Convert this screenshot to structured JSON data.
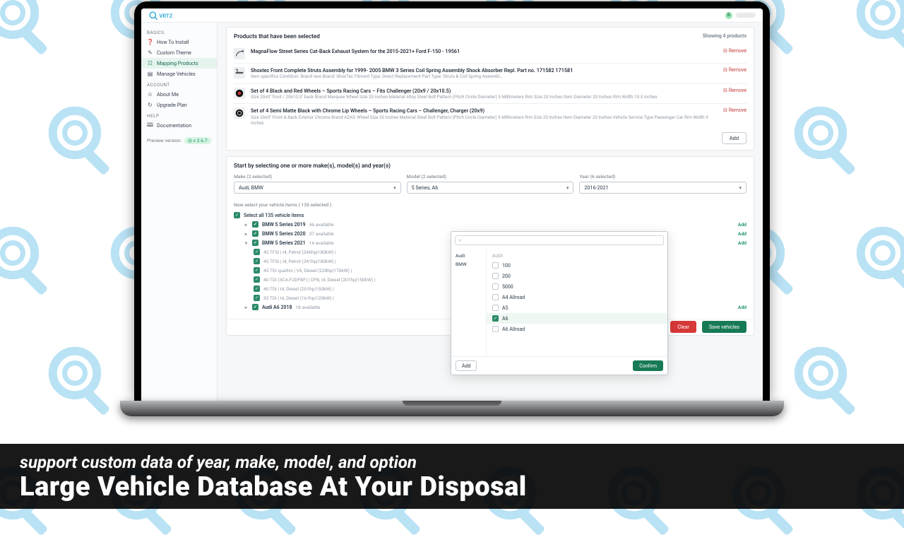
{
  "sidebar": {
    "sections": [
      {
        "label": "BASICS",
        "items": [
          {
            "label": "How To Install",
            "icon": "❓"
          },
          {
            "label": "Custom Theme",
            "icon": "✎"
          },
          {
            "label": "Mapping Products",
            "icon": "☷",
            "active": true
          },
          {
            "label": "Manage Vehicles",
            "icon": "▤"
          }
        ]
      },
      {
        "label": "ACCOUNT",
        "items": [
          {
            "label": "About Me",
            "icon": "☺"
          },
          {
            "label": "Upgrade Plan",
            "icon": "↻"
          }
        ]
      },
      {
        "label": "HELP",
        "items": [
          {
            "label": "Documentation",
            "icon": "🕮"
          }
        ]
      }
    ],
    "preview_label": "Preview version:",
    "preview_version": "◎ v 2.6.7"
  },
  "topbar": {
    "avatar_letter": "D"
  },
  "products": {
    "title": "Products that have been selected",
    "count_label": "Showing 4 products",
    "remove_label": "Remove",
    "add_label": "Add",
    "items": [
      {
        "title": "MagnaFlow Street Series Cat-Back Exhaust System for the 2015-2021+ Ford F-150 - 19561",
        "sub": ""
      },
      {
        "title": "Shoxtec Front Complete Struts Assembly for 1999- 2005 BMW 3 Series Coil Spring Assembly Shock Absorber Repl. Part no. 171582 171581",
        "sub": "Item specifics Condition: Brand new Brand: ShoxTec Fitment Type: Direct Replacement Part Type: Struts & Coil Spring Assembl…"
      },
      {
        "title": "Set of 4 Black and Red Wheels – Sports Racing Cars – Fits Challenger (20x9 / 20x10.5)",
        "sub": "Size 20x9\" front / 20x10.5\" back Brand Marquee Wheel Size 20 Inches Material Alloy Steel Bolt Pattern (Pitch Circle Diameter) 9 Millimeters Rim Size 20 Inches Item Diameter 20 Inches Rim Width 10.5 Inches"
      },
      {
        "title": "Set of 4 Semi Matte Black with Chrome Lip Wheels – Sports Racing Cars – Challenger, Charger (20x9)",
        "sub": "Size 20x9\" Front & Back Exterior Chrome Brand AZAD Wheel Size 20 Inches Material Steel Bolt Pattern (Pitch Circle Diameter) 9 Millimeters Rim Size 20 Inches Item Diameter 20 Inches Vehicle Service Type Passenger Car Rim Width 9 Inches"
      }
    ]
  },
  "selection": {
    "title": "Start by selecting one or more make(s), model(s) and year(s)",
    "make": {
      "label": "Make (2 selected)",
      "value": "Audi, BMW"
    },
    "model": {
      "label": "Model (2 selected)",
      "value": "5 Series, A6"
    },
    "year": {
      "label": "Year (6 selected)",
      "value": "2016-2021"
    },
    "vehicles_header": "Now select your vehicle items ( 135 selected )",
    "select_all": "Select all 135 vehicle items",
    "add_label": "Add",
    "groups": [
      {
        "title": "BMW 5 Series 2019",
        "avail": "46 available"
      },
      {
        "title": "BMW 5 Series 2020",
        "avail": "37 available"
      },
      {
        "title": "BMW 5 Series 2021",
        "avail": "14 available",
        "expanded": true,
        "children": [
          "45 TFSI | I4, Petrol (246hp|180kW) |",
          "45 TFSI | I4, Petrol (241hp|180kW) |",
          "45 TDi quattro | V6, Diesel (228hp|170kW) |",
          "40 TDi (3CA-F2DFBF) | DFB, I4, Diesel (201hp|150kW) |",
          "40 TDi | I4, Diesel (201hp|150kW) |",
          "35 TDi | I4, Diesel (161hp|120kW) |"
        ]
      },
      {
        "title": "Audi A6 2018",
        "avail": "18 available"
      }
    ],
    "clear_label": "Clear",
    "save_label": "Save vehicles"
  },
  "dropdown": {
    "search_placeholder": "⌕",
    "left": [
      "Audi",
      "BMW"
    ],
    "group": "AUDI",
    "items": [
      {
        "label": "100",
        "checked": false
      },
      {
        "label": "200",
        "checked": false
      },
      {
        "label": "5000",
        "checked": false
      },
      {
        "label": "A4 Allroad",
        "checked": false
      },
      {
        "label": "A5",
        "checked": false
      },
      {
        "label": "A6",
        "checked": true
      },
      {
        "label": "A6 Allroad",
        "checked": false
      }
    ],
    "add_label": "Add",
    "confirm_label": "Confirm"
  },
  "caption": {
    "sub": "support custom data of year, make, model, and option",
    "main": "Large Vehicle Database At Your Disposal"
  }
}
